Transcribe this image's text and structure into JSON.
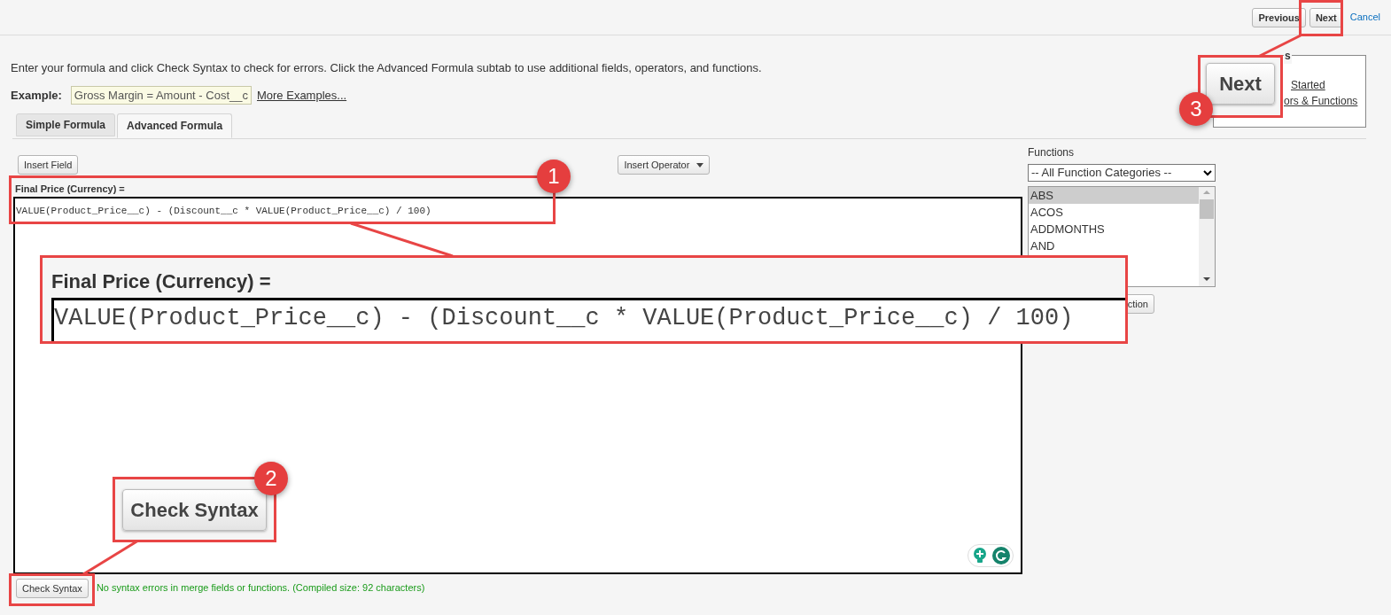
{
  "top_bar": {
    "buttons": [
      {
        "label": "Previous"
      },
      {
        "label": "Next"
      }
    ],
    "cancel": "Cancel"
  },
  "instructions": "Enter your formula and click Check Syntax to check for errors. Click the Advanced Formula subtab to use additional fields, operators, and functions.",
  "example": {
    "label": "Example:",
    "value": "Gross Margin = Amount - Cost__c",
    "link": "More Examples..."
  },
  "quick_tips": {
    "title": "s",
    "links": [
      "Started",
      "ors & Functions"
    ]
  },
  "tabs": [
    {
      "label": "Simple Formula",
      "selected": false
    },
    {
      "label": "Advanced Formula",
      "selected": true
    }
  ],
  "editor": {
    "insert_field": "Insert Field",
    "insert_operator": "Insert Operator",
    "label": "Final Price (Currency) =",
    "formula": "VALUE(Product_Price__c) - (Discount__c * VALUE(Product_Price__c) / 100)",
    "check_syntax": "Check Syntax",
    "result": "No syntax errors in merge fields or functions. (Compiled size: 92 characters)"
  },
  "functions": {
    "label": "Functions",
    "category": "-- All Function Categories --",
    "items": [
      {
        "name": "ABS",
        "selected": true
      },
      {
        "name": "ACOS",
        "selected": false
      },
      {
        "name": "ADDMONTHS",
        "selected": false
      },
      {
        "name": "AND",
        "selected": false
      }
    ],
    "insert_button": "ction"
  },
  "callouts": [
    {
      "number": "1",
      "label": "Final Price (Currency) =",
      "formula": "VALUE(Product_Price__c) - (Discount__c * VALUE(Product_Price__c) / 100)"
    },
    {
      "number": "2",
      "button": "Check Syntax"
    },
    {
      "number": "3",
      "button": "Next"
    }
  ]
}
